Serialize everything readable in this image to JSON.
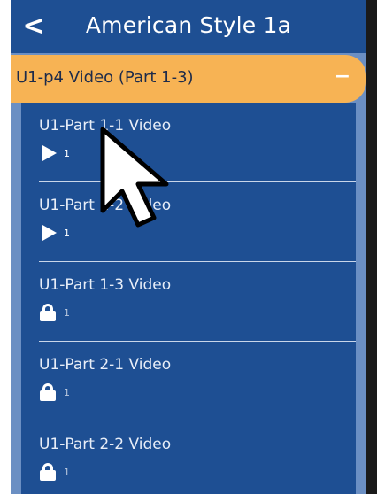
{
  "header": {
    "back_icon": "chevron-left-icon",
    "back_glyph": "<",
    "title": "American Style 1a"
  },
  "section": {
    "label": "U1-p4 Video (Part 1-3)",
    "collapse_glyph": "−",
    "accent": "#f7b354"
  },
  "items": [
    {
      "title": "U1-Part 1-1 Video",
      "status": "play",
      "count": "1"
    },
    {
      "title": "U1-Part 1-2 Video",
      "status": "play",
      "count": "1"
    },
    {
      "title": "U1-Part 1-3 Video",
      "status": "lock",
      "count": "1"
    },
    {
      "title": "U1-Part 2-1 Video",
      "status": "lock",
      "count": "1"
    },
    {
      "title": "U1-Part 2-2 Video",
      "status": "lock",
      "count": "1"
    }
  ],
  "colors": {
    "header_bg": "#1e4f93",
    "frame_bg": "#6b8fc3",
    "text": "#e8eef8"
  },
  "cursor": {
    "icon": "mouse-pointer-icon"
  }
}
